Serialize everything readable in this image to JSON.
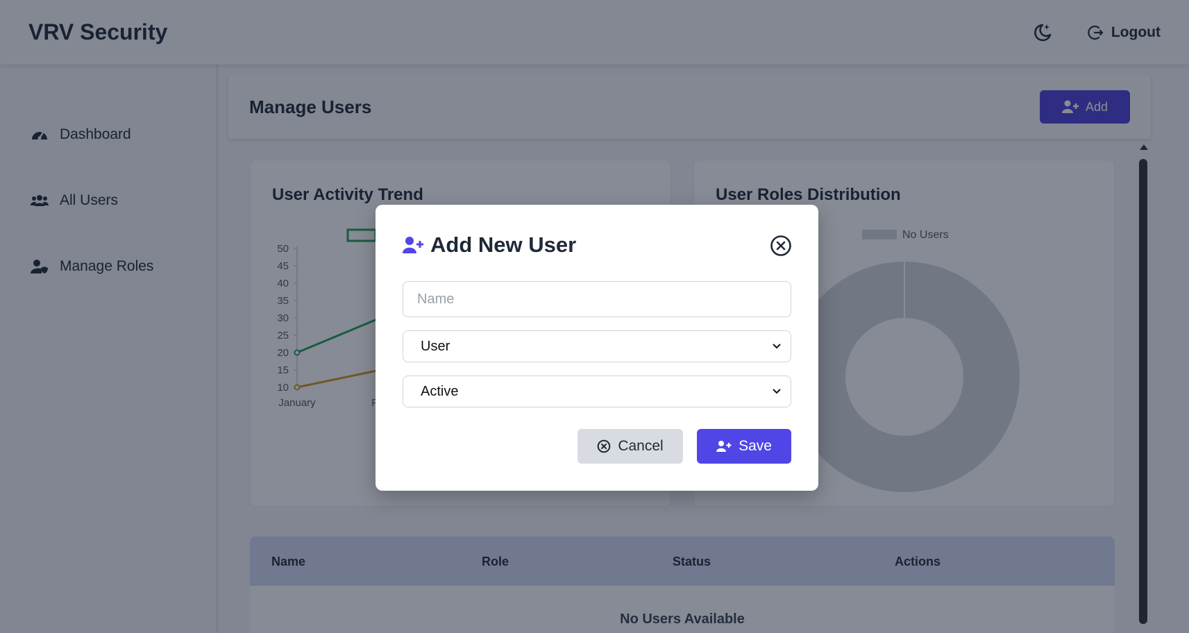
{
  "header": {
    "brand": "VRV Security",
    "logout_label": "Logout"
  },
  "sidebar": {
    "items": [
      {
        "label": "Dashboard",
        "icon": "gauge-icon"
      },
      {
        "label": "All Users",
        "icon": "users-icon"
      },
      {
        "label": "Manage Roles",
        "icon": "user-shield-icon"
      }
    ]
  },
  "main": {
    "title": "Manage Users",
    "add_label": "Add",
    "activity_card": {
      "title": "User Activity Trend",
      "chart_data": {
        "type": "line",
        "x": [
          "January",
          "Feb"
        ],
        "y_ticks": [
          10,
          15,
          20,
          25,
          30,
          35,
          40,
          45,
          50
        ],
        "ylim": [
          10,
          50
        ],
        "series": [
          {
            "color": "#1f9d55",
            "values": [
              20,
              30
            ]
          },
          {
            "color": "#c8961c",
            "values": [
              10,
              15
            ]
          }
        ]
      }
    },
    "roles_card": {
      "title": "User Roles Distribution",
      "chart_data": {
        "type": "pie",
        "legend": [
          "No Users"
        ],
        "values": [
          1
        ],
        "colors": [
          "#cfd2d8"
        ]
      }
    },
    "table": {
      "headers": [
        "Name",
        "Role",
        "Status",
        "Actions"
      ],
      "empty_message": "No Users Available"
    }
  },
  "modal": {
    "title": "Add New User",
    "name_placeholder": "Name",
    "role_value": "User",
    "status_value": "Active",
    "cancel_label": "Cancel",
    "save_label": "Save"
  }
}
